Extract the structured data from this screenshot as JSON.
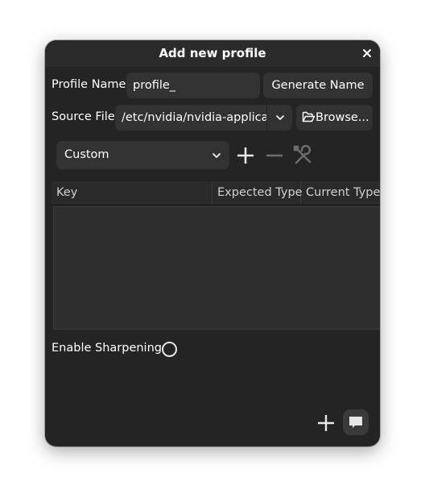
{
  "dialog": {
    "title": "Add new profile",
    "close_glyph": "×"
  },
  "profile_name": {
    "label": "Profile Name",
    "value": "profile_",
    "generate_button": "Generate Name"
  },
  "source_file": {
    "label": "Source File",
    "value": "/etc/nvidia/nvidia-applicat",
    "browse_button": "Browse..."
  },
  "preset": {
    "selected": "Custom"
  },
  "table": {
    "columns": [
      "Key",
      "Expected Type",
      "Current Type"
    ],
    "rows": []
  },
  "sharpening": {
    "label": "Enable Sharpening",
    "enabled": false
  },
  "icons": {
    "add": "plus-icon",
    "remove": "minus-icon",
    "tools": "wrench-screwdriver-icon",
    "folder": "folder-open-icon",
    "dropdown": "chevron-down-icon",
    "toast": "message-icon"
  },
  "colors": {
    "window_bg": "#242424",
    "field_bg": "#323232",
    "text": "#ffffff"
  }
}
